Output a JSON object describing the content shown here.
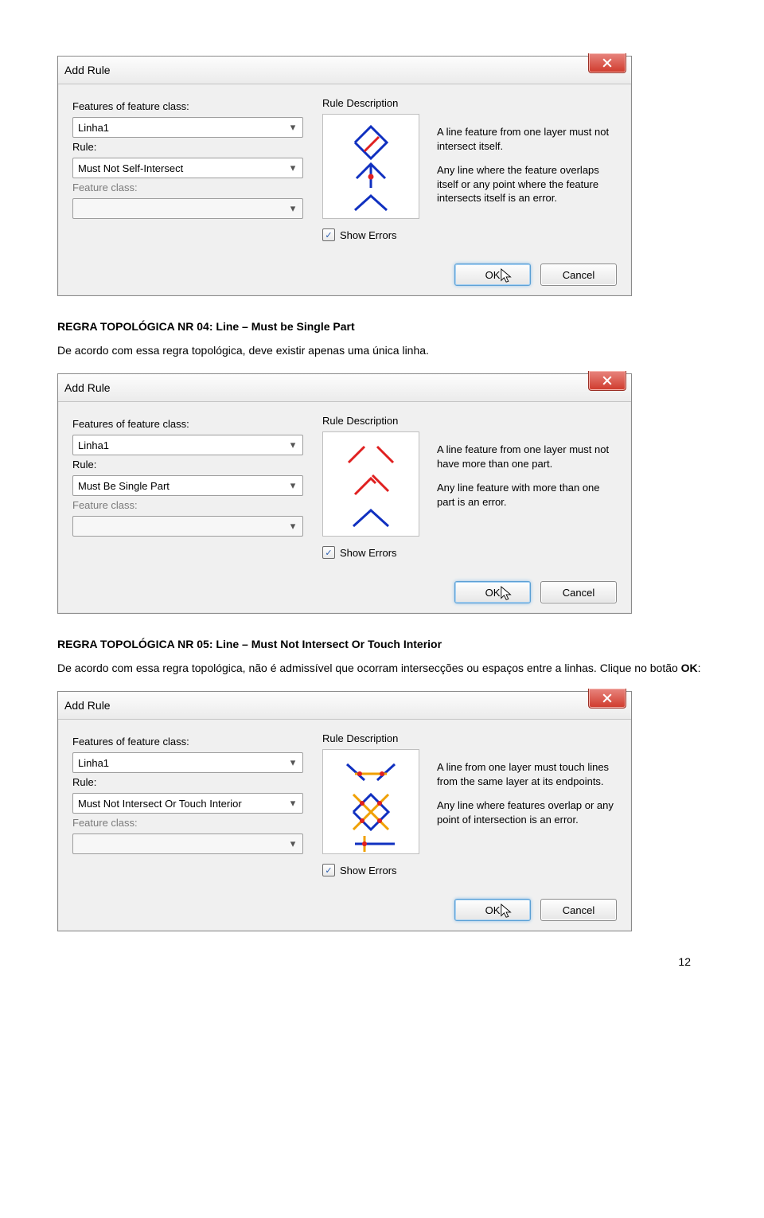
{
  "dialog1": {
    "title": "Add Rule",
    "labels": {
      "features": "Features of feature class:",
      "rule": "Rule:",
      "featureClass": "Feature class:"
    },
    "fields": {
      "features": "Linha1",
      "rule": "Must Not Self-Intersect",
      "featureClass": ""
    },
    "ruleDescLabel": "Rule Description",
    "showErrors": "Show Errors",
    "desc1": "A line feature from one layer must not intersect itself.",
    "desc2": "Any line where the feature overlaps itself or any point where the feature intersects itself is an error.",
    "ok": "OK",
    "cancel": "Cancel"
  },
  "heading1": "REGRA TOPOLÓGICA NR 04: Line – Must be Single Part",
  "para1": "De acordo com essa regra topológica, deve existir apenas uma única linha.",
  "dialog2": {
    "title": "Add Rule",
    "labels": {
      "features": "Features of feature class:",
      "rule": "Rule:",
      "featureClass": "Feature class:"
    },
    "fields": {
      "features": "Linha1",
      "rule": "Must Be Single Part",
      "featureClass": ""
    },
    "ruleDescLabel": "Rule Description",
    "showErrors": "Show Errors",
    "desc1": "A line feature from one layer must not have more than one part.",
    "desc2": "Any line feature with more than one part is an error.",
    "ok": "OK",
    "cancel": "Cancel"
  },
  "heading2": "REGRA TOPOLÓGICA NR 05: Line – Must Not Intersect Or Touch Interior",
  "para2": "De acordo com essa regra topológica, não é admissível que ocorram intersecções ou espaços entre a linhas. Clique no botão ",
  "para2b": "OK",
  "para2c": ":",
  "dialog3": {
    "title": "Add Rule",
    "labels": {
      "features": "Features of feature class:",
      "rule": "Rule:",
      "featureClass": "Feature class:"
    },
    "fields": {
      "features": "Linha1",
      "rule": "Must Not Intersect Or Touch Interior",
      "featureClass": ""
    },
    "ruleDescLabel": "Rule Description",
    "showErrors": "Show Errors",
    "desc1": "A line from one layer must touch lines from the same layer at its endpoints.",
    "desc2": "Any line where features overlap or any point of intersection is an error.",
    "ok": "OK",
    "cancel": "Cancel"
  },
  "pageNumber": "12"
}
